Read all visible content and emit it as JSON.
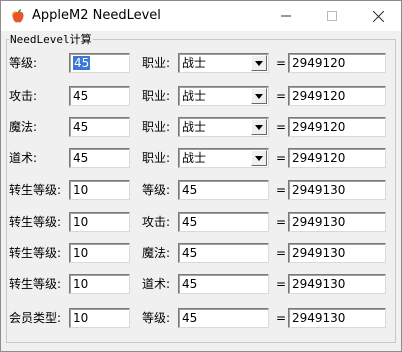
{
  "window": {
    "title": "AppleM2 NeedLevel"
  },
  "group": {
    "label": "NeedLevel计算"
  },
  "rows": [
    {
      "label1": "等级:",
      "value1": "45",
      "label2": "职业:",
      "value2": "战士",
      "kind": "combo",
      "eq": "=",
      "result": "2949120"
    },
    {
      "label1": "攻击:",
      "value1": "45",
      "label2": "职业:",
      "value2": "战士",
      "kind": "combo",
      "eq": "=",
      "result": "2949120"
    },
    {
      "label1": "魔法:",
      "value1": "45",
      "label2": "职业:",
      "value2": "战士",
      "kind": "combo",
      "eq": "=",
      "result": "2949120"
    },
    {
      "label1": "道术:",
      "value1": "45",
      "label2": "职业:",
      "value2": "战士",
      "kind": "combo",
      "eq": "=",
      "result": "2949120"
    },
    {
      "label1": "转生等级:",
      "value1": "10",
      "label2": "等级:",
      "value2": "45",
      "kind": "edit",
      "eq": "=",
      "result": "2949130"
    },
    {
      "label1": "转生等级:",
      "value1": "10",
      "label2": "攻击:",
      "value2": "45",
      "kind": "edit",
      "eq": "=",
      "result": "2949130"
    },
    {
      "label1": "转生等级:",
      "value1": "10",
      "label2": "魔法:",
      "value2": "45",
      "kind": "edit",
      "eq": "=",
      "result": "2949130"
    },
    {
      "label1": "转生等级:",
      "value1": "10",
      "label2": "道术:",
      "value2": "45",
      "kind": "edit",
      "eq": "=",
      "result": "2949130"
    },
    {
      "label1": "会员类型:",
      "value1": "10",
      "label2": "等级:",
      "value2": "45",
      "kind": "edit",
      "eq": "=",
      "result": "2949130"
    }
  ]
}
